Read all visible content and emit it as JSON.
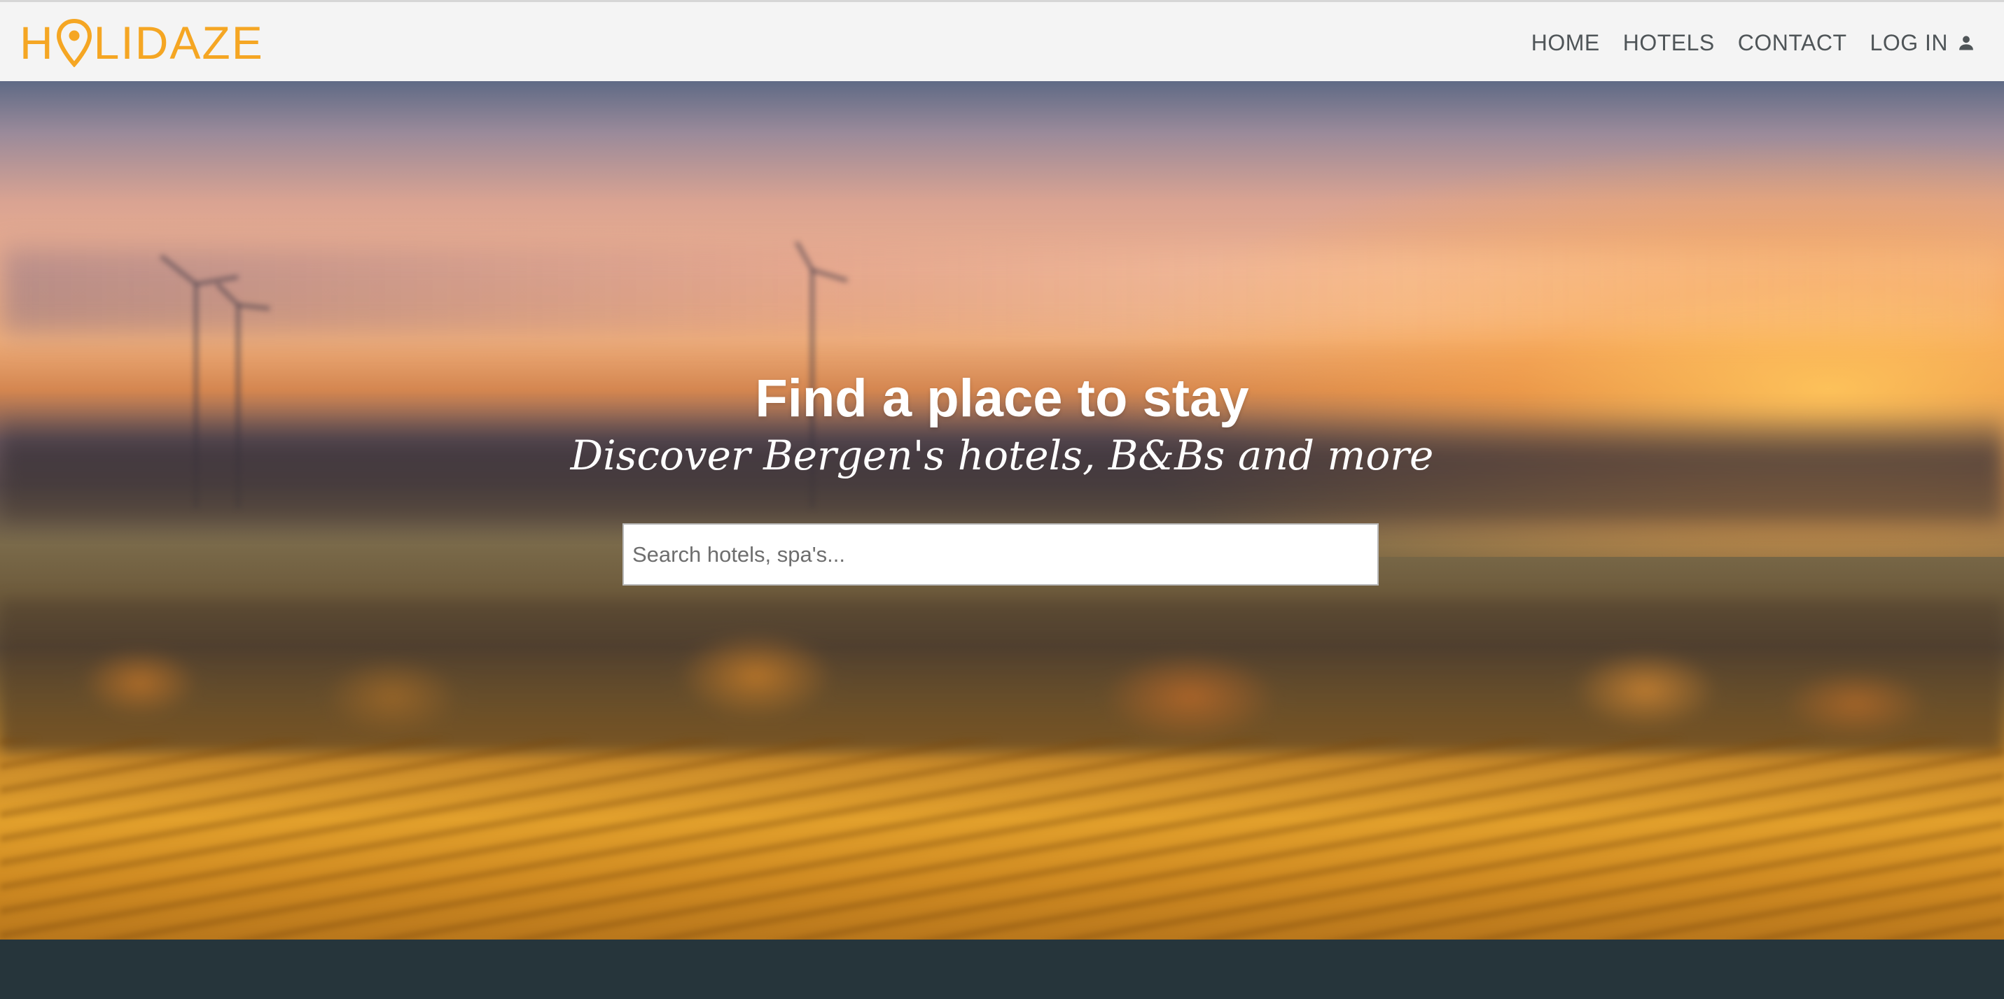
{
  "brand": {
    "logo_prefix": "H",
    "logo_suffix": "LIDAZE",
    "logo_color": "#f5a623",
    "logo_icon": "map-pin-icon"
  },
  "nav": {
    "items": [
      {
        "label": "HOME"
      },
      {
        "label": "HOTELS"
      },
      {
        "label": "CONTACT"
      },
      {
        "label": "LOG IN",
        "icon": "user-icon"
      }
    ]
  },
  "hero": {
    "title": "Find a place to stay",
    "subtitle": "Discover Bergen's hotels, B&Bs and more",
    "search": {
      "placeholder": "Search hotels, spa's...",
      "value": ""
    }
  },
  "colors": {
    "navbar_bg": "#f4f4f4",
    "nav_text": "#4f5558",
    "footer_bg": "#26353b"
  }
}
